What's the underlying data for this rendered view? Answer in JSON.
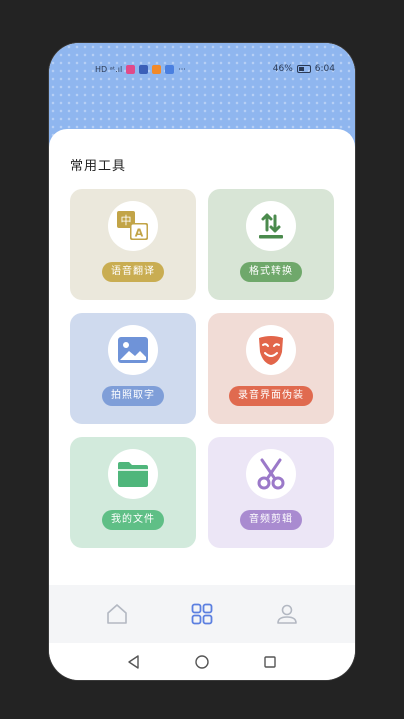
{
  "status_bar": {
    "carrier_glyphs": "HD ᵃᵗ.ıl",
    "dots": "···",
    "battery": "46%",
    "time": "6:04"
  },
  "section": {
    "title": "常用工具"
  },
  "tools": [
    {
      "label": "语音翻译",
      "icon": "translate-icon",
      "tile_bg": "#ebe8dc",
      "pill_bg": "#c9ad52"
    },
    {
      "label": "格式转换",
      "icon": "convert-icon",
      "tile_bg": "#d8e5d6",
      "pill_bg": "#6fa86b"
    },
    {
      "label": "拍照取字",
      "icon": "image-icon",
      "tile_bg": "#cfdaee",
      "pill_bg": "#7f9ed8"
    },
    {
      "label": "录音界面伪装",
      "icon": "mask-icon",
      "tile_bg": "#f1dcd6",
      "pill_bg": "#e06a4f"
    },
    {
      "label": "我的文件",
      "icon": "folder-icon",
      "tile_bg": "#d2eadc",
      "pill_bg": "#5fbf86"
    },
    {
      "label": "音频剪辑",
      "icon": "scissors-icon",
      "tile_bg": "#ece6f6",
      "pill_bg": "#a98bd0"
    }
  ],
  "translate_icon_text": {
    "zh": "中",
    "en": "A"
  },
  "nav": [
    {
      "name": "home",
      "icon": "home-icon"
    },
    {
      "name": "apps",
      "icon": "apps-grid-icon",
      "active": true
    },
    {
      "name": "profile",
      "icon": "user-icon"
    }
  ],
  "colors": {
    "accent": "#5b7fe0",
    "top_band": "#8fb6ef"
  }
}
